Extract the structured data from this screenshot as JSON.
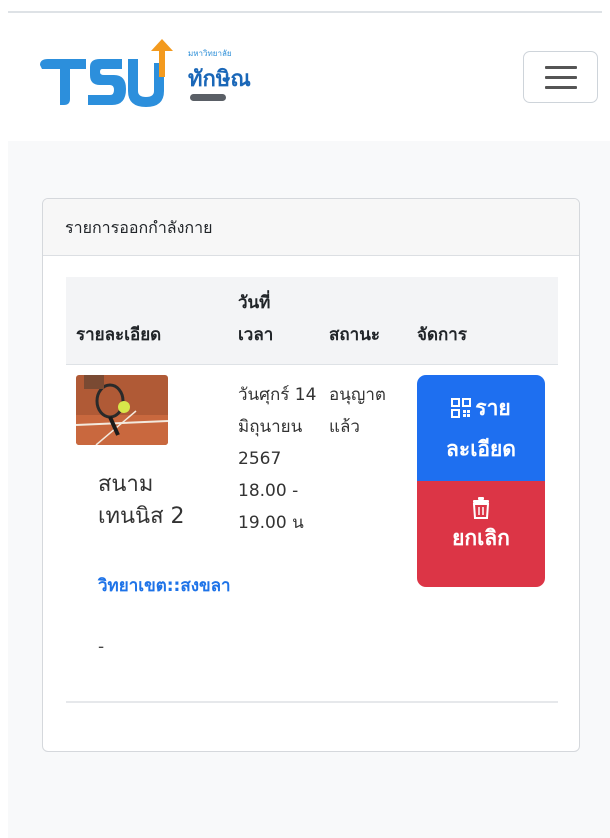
{
  "brand": {
    "logo_letters": "TSU",
    "university_small": "มหาวิทยาลัย",
    "university_name": "ทักษิณ"
  },
  "card": {
    "title": "รายการออกกำลังกาย"
  },
  "table": {
    "headers": {
      "detail": "รายละเอียด",
      "datetime_line1": "วันที่",
      "datetime_line2": "เวลา",
      "status": "สถานะ",
      "manage": "จัดการ"
    },
    "rows": [
      {
        "court_name": "สนามเทนนิส 2",
        "campus": "วิทยาเขต::สงขลา",
        "note": "-",
        "datetime": "วันศุกร์ 14 มิถุนายน 2567 18.00 - 19.00 น",
        "status": "อนุญาตแล้ว",
        "detail_button": "รายละเอียด",
        "cancel_button": "ยกเลิก"
      }
    ]
  },
  "colors": {
    "primary": "#1e6ff0",
    "danger": "#dc3546",
    "link": "#1e73e8"
  },
  "icons": {
    "menu": "hamburger-icon",
    "detail": "qr-grid-icon",
    "cancel": "trash-icon"
  }
}
